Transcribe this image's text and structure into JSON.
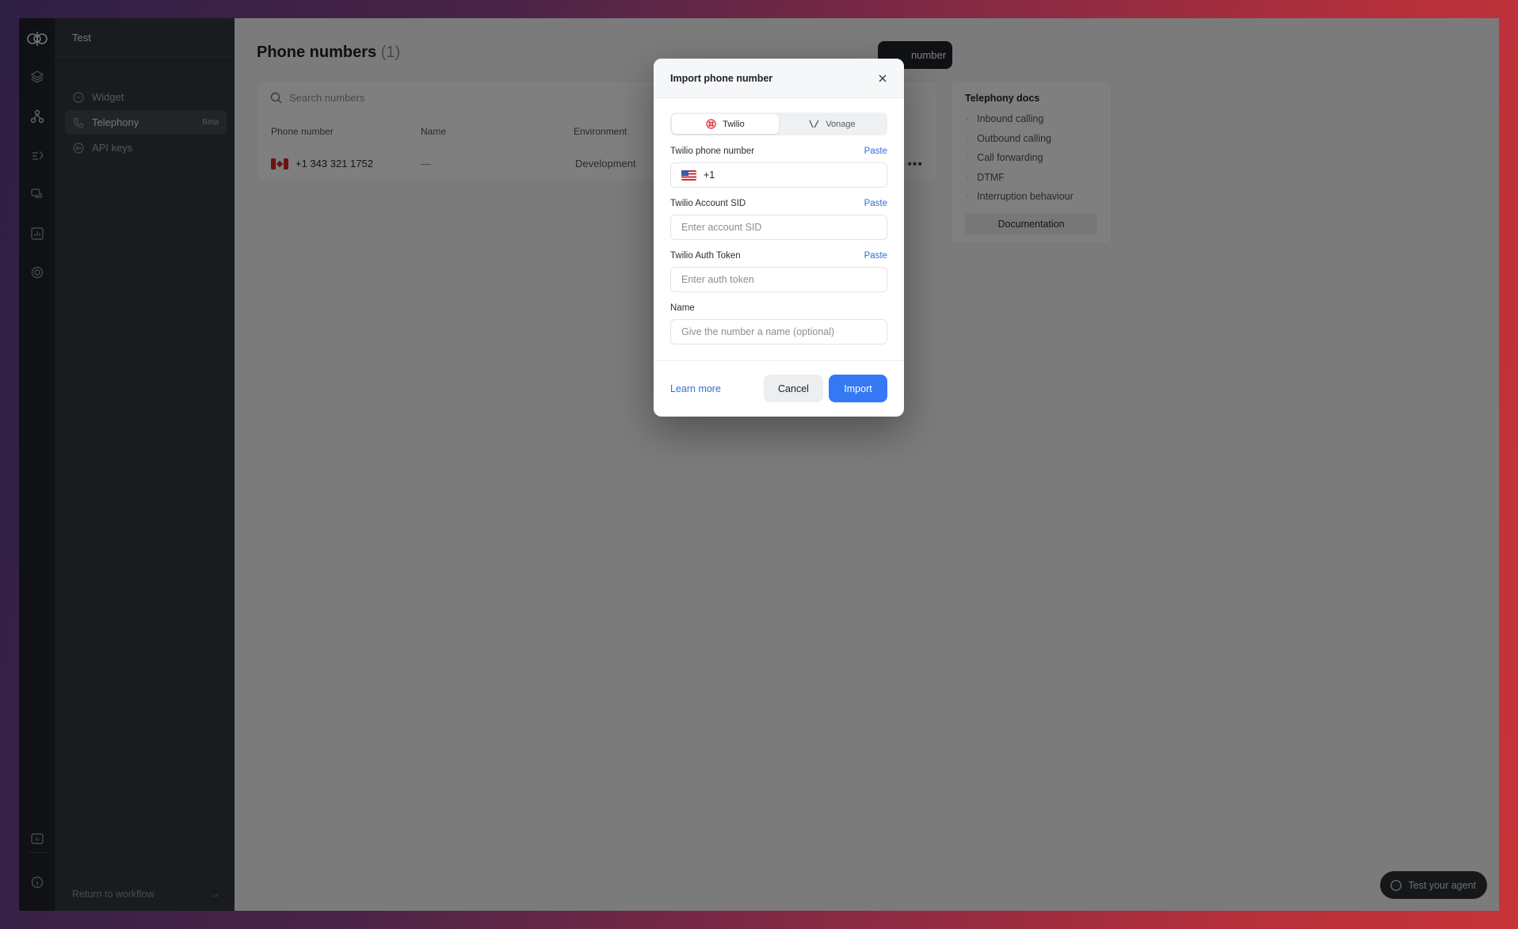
{
  "sidebar": {
    "workspace": "Test",
    "items": [
      {
        "label": "Widget",
        "icon": "widget-icon",
        "badge": ""
      },
      {
        "label": "Telephony",
        "icon": "phone-icon",
        "badge": "Beta"
      },
      {
        "label": "API keys",
        "icon": "key-icon",
        "badge": ""
      }
    ],
    "return_label": "Return to workflow"
  },
  "main": {
    "title": "Phone numbers",
    "count": "(1)",
    "add_button": "number",
    "search_placeholder": "Search numbers",
    "columns": [
      "Phone number",
      "Name",
      "Environment"
    ],
    "rows": [
      {
        "phone": "+1 343 321 1752",
        "name": "—",
        "environment": "Development"
      }
    ]
  },
  "docs": {
    "title": "Telephony docs",
    "items": [
      "Inbound calling",
      "Outbound calling",
      "Call forwarding",
      "DTMF",
      "Interruption behaviour"
    ],
    "button": "Documentation"
  },
  "test_agent": "Test your agent",
  "modal": {
    "title": "Import phone number",
    "providers": [
      "Twilio",
      "Vonage"
    ],
    "selected_provider": "Twilio",
    "fields": {
      "phone": {
        "label": "Twilio phone number",
        "paste": "Paste",
        "value": "+1"
      },
      "sid": {
        "label": "Twilio Account SID",
        "paste": "Paste",
        "placeholder": "Enter account SID"
      },
      "token": {
        "label": "Twilio Auth Token",
        "paste": "Paste",
        "placeholder": "Enter auth token"
      },
      "name": {
        "label": "Name",
        "placeholder": "Give the number a name (optional)"
      }
    },
    "learn_more": "Learn more",
    "cancel": "Cancel",
    "import": "Import"
  },
  "colors": {
    "accent": "#3478f6",
    "link": "#2f6fdc",
    "sidebar": "#33383e",
    "rail": "#1f2328"
  }
}
